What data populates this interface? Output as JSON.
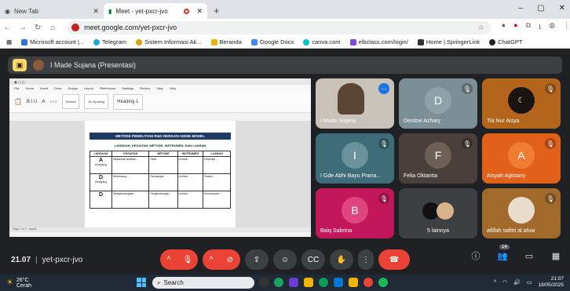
{
  "browser": {
    "tabs": [
      {
        "label": "New Tab",
        "active": false
      },
      {
        "label": "Meet - yet-pxcr-jvo",
        "active": true
      }
    ],
    "new_tab": "+",
    "window_controls": [
      "–",
      "▢",
      "✕"
    ],
    "url": "meet.google.com/yet-pxcr-jvo",
    "bookmarks": [
      {
        "label": "Microsoft account |...",
        "color": "#2f6fde"
      },
      {
        "label": "Telegram",
        "color": "#2aa1da"
      },
      {
        "label": "Sistem Informasi Ak...",
        "color": "#d8a400"
      },
      {
        "label": "Beranda",
        "color": "#f2b300"
      },
      {
        "label": "Google Docs",
        "color": "#4285f4"
      },
      {
        "label": "canva.com",
        "color": "#00c4cc"
      },
      {
        "label": "elbclass.com/login/",
        "color": "#7b4bd6"
      },
      {
        "label": "Home | SpringerLink",
        "color": "#333333"
      },
      {
        "label": "ChatGPT",
        "color": "#202124"
      }
    ]
  },
  "meet": {
    "presenter_label": "I Made Sujana (Presentasi)",
    "shared_doc": {
      "title": "METODE PENELITIAN R&D DENGAN ADDIE MODEL",
      "subtitle": "LANGKAH, KEGIATAN, METODE, INSTRUMEN, DAN LUARAN",
      "headers": [
        "LANGKAH",
        "KEGIATAN",
        "METODE",
        "INSTRUMEN",
        "LUARAN"
      ],
      "rows": [
        {
          "step": "A",
          "step_name": "Analyzing",
          "kegiatan": "Melakukan analisis ...",
          "metode": "Studi ...",
          "instrumen": "Lembar ...",
          "luaran": "Deskripsi ..."
        },
        {
          "step": "D",
          "step_name": "Designing",
          "kegiatan": "Merancang ...",
          "metode": "Rancangan",
          "instrumen": "Lembar ...",
          "luaran": "Desain ..."
        },
        {
          "step": "D",
          "step_name": "",
          "kegiatan": "Mengembangkan ...",
          "metode": "Pengembangan",
          "instrumen": "Lembar ...",
          "luaran": "Kemampuan ..."
        }
      ]
    },
    "tiles": [
      {
        "name": "I Made Sujana",
        "letter": "",
        "color": "#c9c2b8"
      },
      {
        "name": "Destine Azhary",
        "letter": "D",
        "color": "#7c8f97"
      },
      {
        "name": "Tia Nur Aisya",
        "letter": "",
        "color": "#b4651c"
      },
      {
        "name": "I Gde Abhi Bayu Prana...",
        "letter": "I",
        "color": "#3e6c78"
      },
      {
        "name": "Felia Oktantia",
        "letter": "F",
        "color": "#4a3f3a"
      },
      {
        "name": "Aisyah Agistany",
        "letter": "A",
        "color": "#e2611a"
      },
      {
        "name": "Baiq Sabrina",
        "letter": "B",
        "color": "#c2185b"
      },
      {
        "name": "5 lainnya",
        "letter": "",
        "color": "#3c4043"
      },
      {
        "name": "afilfah safitri al afuw",
        "letter": "",
        "color": "#a1692a"
      }
    ]
  },
  "controls": {
    "time": "21.07",
    "separator": "|",
    "meeting_code": "yet-pxcr-jvo",
    "participants_badge": "14"
  },
  "taskbar": {
    "temp": "26°C",
    "weather": "Cerah",
    "search_placeholder": "Search",
    "time": "21:07",
    "date": "18/05/2025"
  },
  "colors": {
    "meet_bg": "#202124",
    "red_button": "#ea4335",
    "gray_button": "#3c4043"
  }
}
